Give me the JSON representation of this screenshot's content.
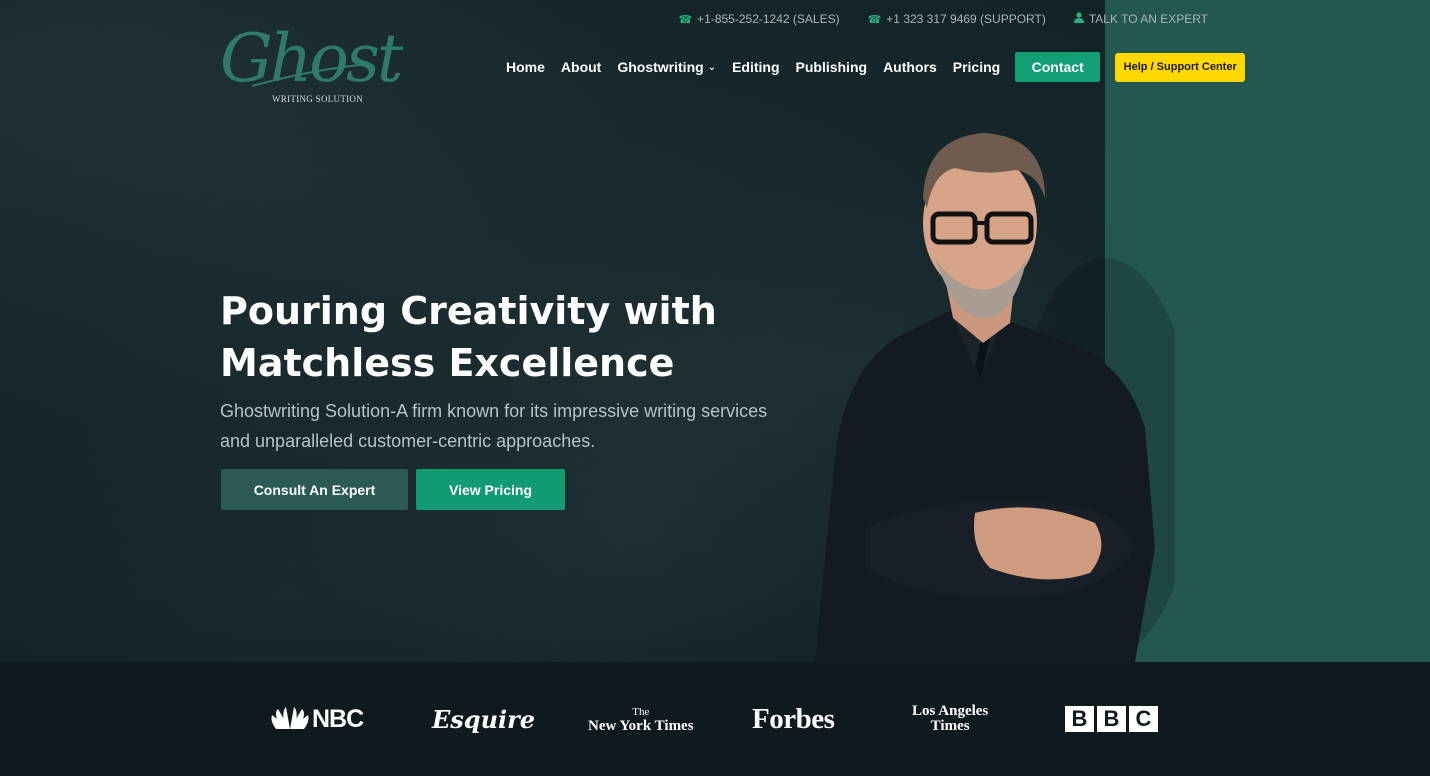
{
  "topbar": {
    "sales": "+1-855-252-1242 (SALES)",
    "support": "+1 323 317 9469 (SUPPORT)",
    "expert": "TALK TO AN EXPERT"
  },
  "logo": {
    "word": "Ghost",
    "sub": "WRITING SOLUTION"
  },
  "nav": {
    "items": [
      "Home",
      "About",
      "Ghostwriting",
      "Editing",
      "Publishing",
      "Authors",
      "Pricing"
    ],
    "contact": "Contact",
    "help": "Help / Support Center"
  },
  "hero": {
    "title_line1": "Pouring Creativity with",
    "title_line2": "Matchless Excellence",
    "subtitle_line1": "Ghostwriting Solution-A firm known for its impressive writing services",
    "subtitle_line2": "and unparalleled customer-centric approaches.",
    "consult": "Consult An Expert",
    "pricing": "View Pricing"
  },
  "press": {
    "nbc": "NBC",
    "esquire": "Esquire",
    "nyt_the": "The",
    "nyt": "New York Times",
    "forbes": "Forbes",
    "lat_1": "Los Angeles",
    "lat_2": "Times",
    "bbc": [
      "B",
      "B",
      "C"
    ]
  },
  "colors": {
    "accent": "#139e76",
    "panel": "#24574f",
    "help": "#ffd800",
    "background": "#15252a"
  },
  "icons": [
    "phone-icon",
    "phone-icon",
    "user-icon",
    "chevron-down-icon",
    "nbc-peacock-icon"
  ]
}
